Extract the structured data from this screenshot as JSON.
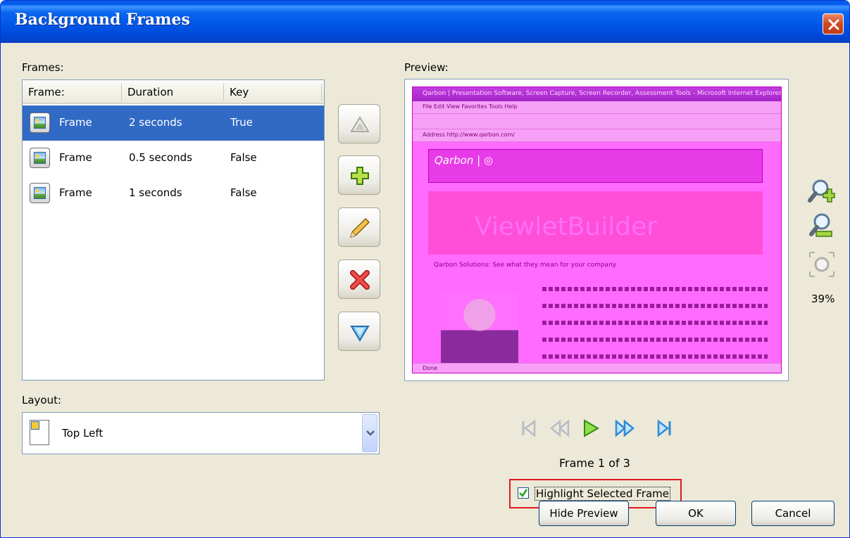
{
  "window": {
    "title": "Background Frames"
  },
  "frames": {
    "label": "Frames:",
    "columns": [
      "Frame:",
      "Duration",
      "Key"
    ],
    "rows": [
      {
        "name": "Frame",
        "duration": "2 seconds",
        "key": "True",
        "selected": true
      },
      {
        "name": "Frame",
        "duration": "0.5 seconds",
        "key": "False",
        "selected": false
      },
      {
        "name": "Frame",
        "duration": "1 seconds",
        "key": "False",
        "selected": false
      }
    ]
  },
  "side_buttons": [
    "move-up",
    "add",
    "edit",
    "delete",
    "move-down"
  ],
  "preview": {
    "label": "Preview:",
    "zoom": "39%",
    "frame_counter": "Frame 1 of 3",
    "browser_title": "Qarbon | Presentation Software, Screen Capture, Screen Recorder, Assessment Tools - Microsoft Internet Explorer",
    "browser_menu": "File   Edit   View   Favorites   Tools   Help",
    "browser_address": "Address  http://www.qarbon.com/",
    "site_logo": "Qarbon | ◎",
    "site_banner": "ViewletBuilder",
    "site_tagline": "Qarbon Solutions: See what they mean for your company",
    "browser_status": "Done"
  },
  "layout": {
    "label": "Layout:",
    "selected": "Top Left"
  },
  "highlight_checkbox": {
    "label": "Highlight Selected Frame",
    "checked": true
  },
  "buttons": {
    "hide_preview": "Hide Preview",
    "ok": "OK",
    "cancel": "Cancel"
  },
  "colors": {
    "title_bar": "#0055e5",
    "selection": "#316ac5",
    "preview_tint": "#ff6bff",
    "highlight_border": "#e2181f"
  }
}
